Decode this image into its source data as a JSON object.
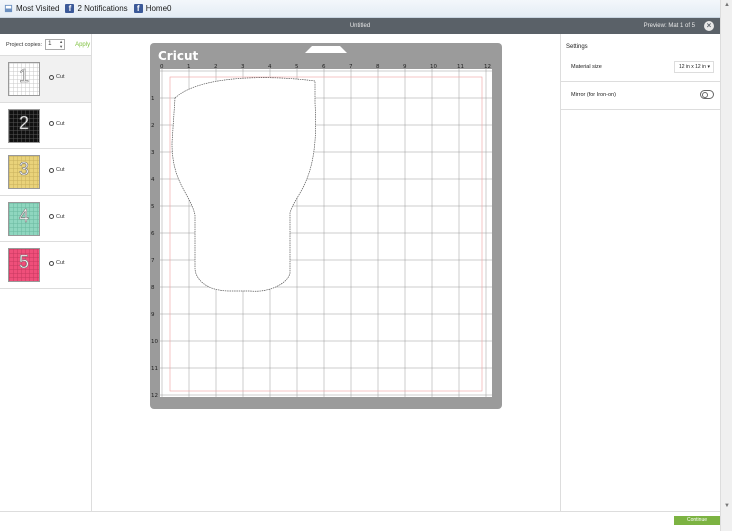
{
  "bookmarks": [
    {
      "label": "Most Visited",
      "icon": "bookmark-star-icon"
    },
    {
      "label": "2 Notifications",
      "icon": "facebook-icon"
    },
    {
      "label": "Home0",
      "icon": "facebook-icon"
    }
  ],
  "window": {
    "title": "Untitled",
    "preview": "Preview: Mat 1 of 5"
  },
  "left": {
    "copies_label": "Project copies:",
    "copies_value": "1",
    "apply_label": "Apply",
    "mats": [
      {
        "num": "1",
        "color": "#ffffff",
        "grid": "#c8c8c8",
        "label": "Cut"
      },
      {
        "num": "2",
        "color": "#111111",
        "grid": "#555555",
        "label": "Cut"
      },
      {
        "num": "3",
        "color": "#e9d27a",
        "grid": "#c8b05c",
        "label": "Cut"
      },
      {
        "num": "4",
        "color": "#8fd6bf",
        "grid": "#6ab89f",
        "label": "Cut"
      },
      {
        "num": "5",
        "color": "#ef4f7a",
        "grid": "#c73960",
        "label": "Cut"
      }
    ]
  },
  "mat": {
    "brand": "Cricut",
    "top_ticks": [
      "0",
      "1",
      "2",
      "3",
      "4",
      "5",
      "6",
      "7",
      "8",
      "9",
      "10",
      "11",
      "12"
    ],
    "left_ticks": [
      "1",
      "2",
      "3",
      "4",
      "5",
      "6",
      "7",
      "8",
      "9",
      "10",
      "11",
      "12"
    ]
  },
  "settings": {
    "title": "Settings",
    "material_size_label": "Material size",
    "material_size_value": "12 in x 12 in",
    "mirror_label": "Mirror (for Iron-on)"
  },
  "footer": {
    "continue_label": "Continue"
  }
}
